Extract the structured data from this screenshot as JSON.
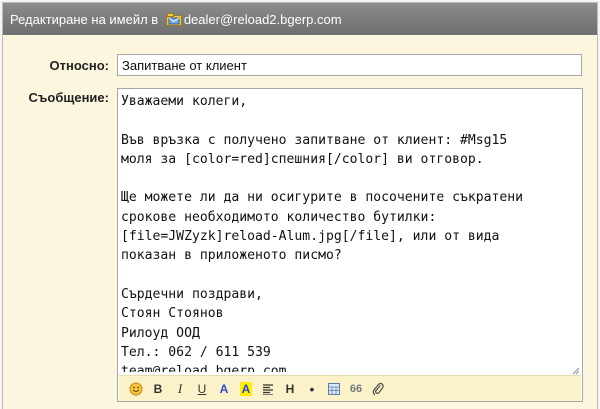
{
  "window": {
    "title_prefix": "Редактиране на имейл в ",
    "email": "dealer@reload2.bgerp.com"
  },
  "form": {
    "subject_label": "Относно",
    "subject_value": "Запитване от клиент",
    "message_label": "Съобщение",
    "message_value": "Уважаеми колеги,\n\nВъв връзка с получено запитване от клиент: #Msg15\nмоля за [color=red]спешния[/color] ви отговор.\n\nЩе можете ли да ни осигурите в посочените съкратени\nсрокове необходимото количество бутилки:\n[file=JWZyzk]reload-Alum.jpg[/file], или от вида\nпоказан в приложеното писмо?\n\nСърдечни поздрави,\nСтоян Стоянов\nРилоуд ООД\nТел.: 062 / 611 539\nteam@reload.bgerp.com\nhttp://www.reload.com"
  },
  "toolbar": {
    "bold": "B",
    "italic": "I",
    "underline": "U",
    "text_color": "A",
    "highlight": "A",
    "heading": "H",
    "bullet": "•",
    "quote": "66"
  },
  "colors": {
    "titlebar": "#7a7a7a",
    "form_bg": "#fdf6de",
    "toolbar_bg": "#fcf2c9",
    "text_color_icon": "#2a4ad6",
    "highlight_bg": "#ffee00"
  }
}
